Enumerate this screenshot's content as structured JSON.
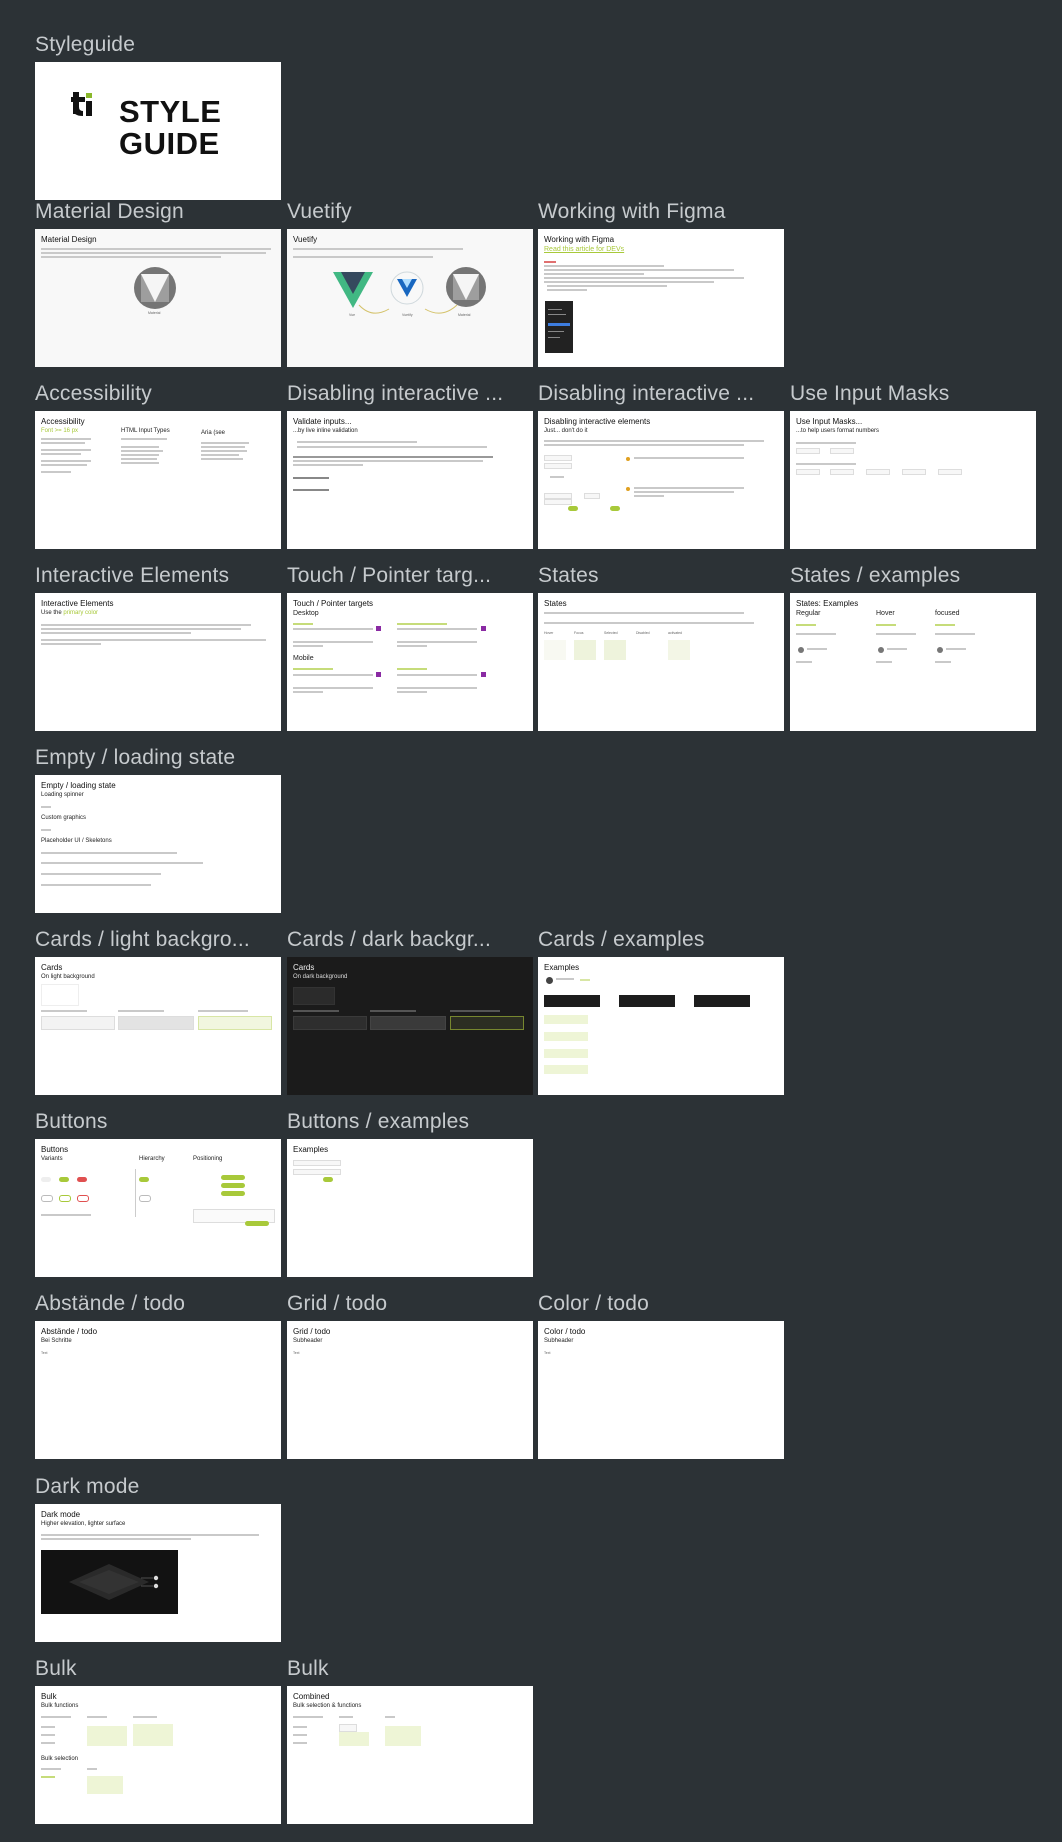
{
  "sections": {
    "styleguide": "Styleguide",
    "material_design": "Material Design",
    "vuetify": "Vuetify",
    "working_with_figma": "Working with Figma",
    "accessibility": "Accessibility",
    "disabling_1": "Disabling interactive ...",
    "disabling_2": "Disabling interactive ...",
    "use_input_masks": "Use Input Masks",
    "interactive_elements": "Interactive Elements",
    "touch_pointer": "Touch / Pointer targ...",
    "states": "States",
    "states_examples": "States / examples",
    "empty_loading": "Empty / loading state",
    "cards_light": "Cards / light backgro...",
    "cards_dark": "Cards / dark backgr...",
    "cards_examples": "Cards / examples",
    "buttons": "Buttons",
    "buttons_examples": "Buttons / examples",
    "abstaende": "Abstände / todo",
    "grid": "Grid / todo",
    "color": "Color / todo",
    "dark_mode": "Dark mode",
    "bulk_1": "Bulk",
    "bulk_2": "Bulk"
  },
  "frames": {
    "cover": {
      "line1": "STYLE",
      "line2": "GUIDE"
    },
    "material": {
      "title": "Material Design",
      "caption": "Material"
    },
    "vuetify": {
      "title": "Vuetify",
      "cap_vue": "Vue",
      "cap_vuetify": "Vuetify",
      "cap_material": "Material"
    },
    "figma": {
      "title": "Working with Figma",
      "link": "Read this article for DEVs"
    },
    "accessibility": {
      "title": "Accessibility",
      "col1": "Font >= 16 px",
      "col2": "HTML Input Types",
      "col3": "Aria (see"
    },
    "disabling1": {
      "title": "Validate inputs...",
      "sub": "...by live inline validation"
    },
    "disabling2": {
      "title": "Disabling interactive elements",
      "sub": "Just... don't do it"
    },
    "masks": {
      "title": "Use Input Masks...",
      "sub": "...to help users format numbers"
    },
    "interactive": {
      "title": "Interactive Elements",
      "sub_prefix": "Use the",
      "sub_accent": "primary color"
    },
    "touch": {
      "title": "Touch / Pointer targets",
      "desktop": "Desktop",
      "mobile": "Mobile"
    },
    "states": {
      "title": "States",
      "labels": [
        "Hover",
        "Focus",
        "Selected",
        "Disabled",
        "activated"
      ]
    },
    "states_ex": {
      "title": "States: Examples",
      "regular": "Regular",
      "hover": "Hover",
      "focused": "focused"
    },
    "empty": {
      "title": "Empty / loading state",
      "loading": "Loading spinner",
      "custom": "Custom graphics",
      "placeholder": "Placeholder UI / Skeletons"
    },
    "cards_light": {
      "title": "Cards",
      "sub": "On light background"
    },
    "cards_dark": {
      "title": "Cards",
      "sub": "On dark background"
    },
    "cards_ex": {
      "title": "Examples"
    },
    "buttons": {
      "title": "Buttons",
      "variants": "Variants",
      "hierarchy": "Hierarchy",
      "positioning": "Positioning"
    },
    "buttons_ex": {
      "title": "Examples"
    },
    "abstaende": {
      "title": "Abstände / todo",
      "sub": "Bei Schritte",
      "text": "Text"
    },
    "grid": {
      "title": "Grid / todo",
      "sub": "Subheader",
      "text": "Text"
    },
    "color": {
      "title": "Color / todo",
      "sub": "Subheader",
      "text": "Text"
    },
    "dark": {
      "title": "Dark mode",
      "sub": "Higher elevation, lighter surface"
    },
    "bulk1": {
      "title": "Bulk",
      "sub": "Bulk functions",
      "sub2": "Bulk selection"
    },
    "bulk2": {
      "title": "Combined",
      "sub": "Bulk selection & functions"
    }
  },
  "colors": {
    "background": "#2c3236",
    "title": "#c6cacd",
    "accent": "#a8c93a",
    "purple": "#8a2aa3"
  }
}
